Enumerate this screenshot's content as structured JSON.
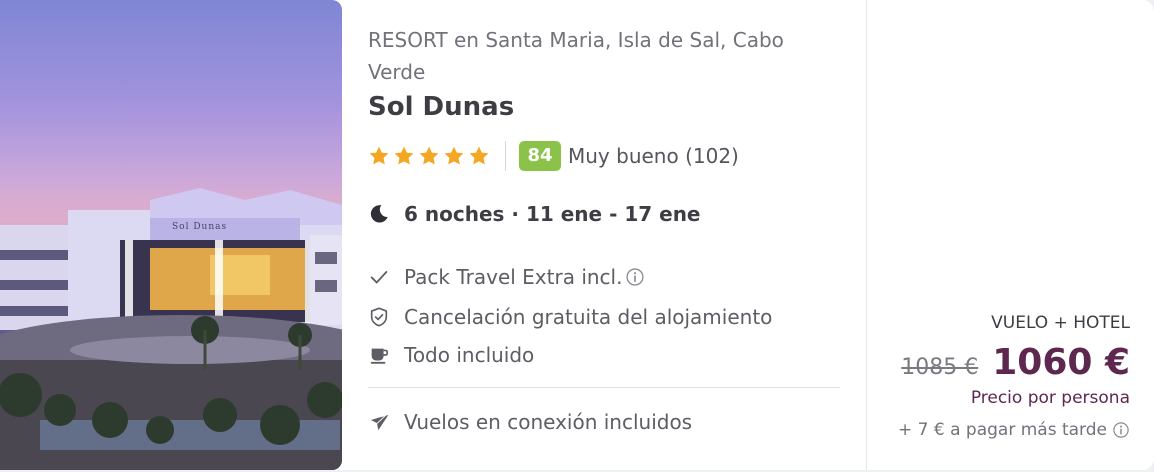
{
  "hotel": {
    "location": "RESORT en Santa Maria, Isla de Sal, Cabo Verde",
    "name": "Sol Dunas",
    "stars": 5,
    "score": "84",
    "score_label": "Muy bueno (102)",
    "photo_sign": "Sol Dunas"
  },
  "trip": {
    "dates": "6 noches · 11 ene - 17 ene"
  },
  "features": [
    {
      "icon": "check-icon",
      "label": "Pack Travel Extra incl."
    },
    {
      "icon": "shield-check-icon",
      "label": "Cancelación gratuita del alojamiento"
    },
    {
      "icon": "cup-icon",
      "label": "Todo incluido"
    },
    {
      "icon": "plane-icon",
      "label": "Vuelos en conexión incluidos"
    }
  ],
  "price": {
    "package_type": "VUELO + HOTEL",
    "old_price": "1085 €",
    "new_price": "1060 €",
    "per_person": "Precio por persona",
    "extra": "+ 7 € a pagar más tarde"
  },
  "colors": {
    "score_bg": "#8bc34a",
    "star": "#f5a623",
    "price": "#5e2750"
  }
}
